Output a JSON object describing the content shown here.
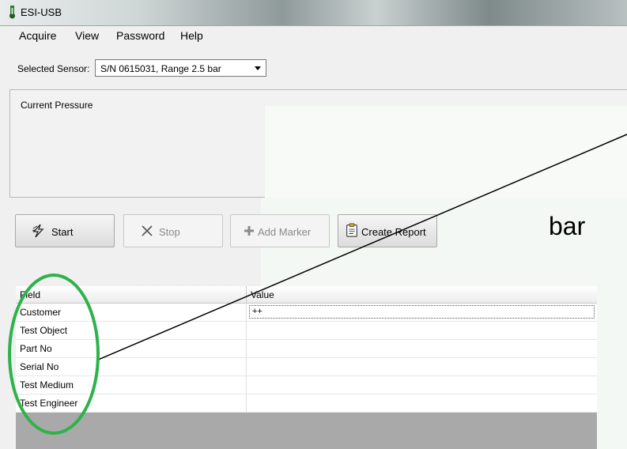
{
  "window": {
    "title": "ESI-USB"
  },
  "menu": [
    "Acquire",
    "View",
    "Password",
    "Help"
  ],
  "sensor": {
    "label": "Selected Sensor:",
    "value": "S/N 0615031, Range 2.5 bar"
  },
  "pressure": {
    "label": "Current Pressure",
    "unit": "bar"
  },
  "buttons": {
    "start": "Start",
    "stop": "Stop",
    "add_marker": "Add Marker",
    "create_report": "Create Report"
  },
  "grid": {
    "headers": {
      "field": "Field",
      "value": "Value"
    },
    "rows": [
      {
        "field": "Customer",
        "value": "++"
      },
      {
        "field": "Test Object",
        "value": ""
      },
      {
        "field": "Part No",
        "value": ""
      },
      {
        "field": "Serial No",
        "value": ""
      },
      {
        "field": "Test Medium",
        "value": ""
      },
      {
        "field": "Test Engineer",
        "value": ""
      }
    ]
  },
  "annotation": {
    "ellipse_color": "#2db34a",
    "line_color": "#000000"
  },
  "icons": {
    "app": "thermometer-icon",
    "start": "lightning-icon",
    "stop": "x-icon",
    "marker": "plus-icon",
    "report": "clipboard-icon"
  }
}
